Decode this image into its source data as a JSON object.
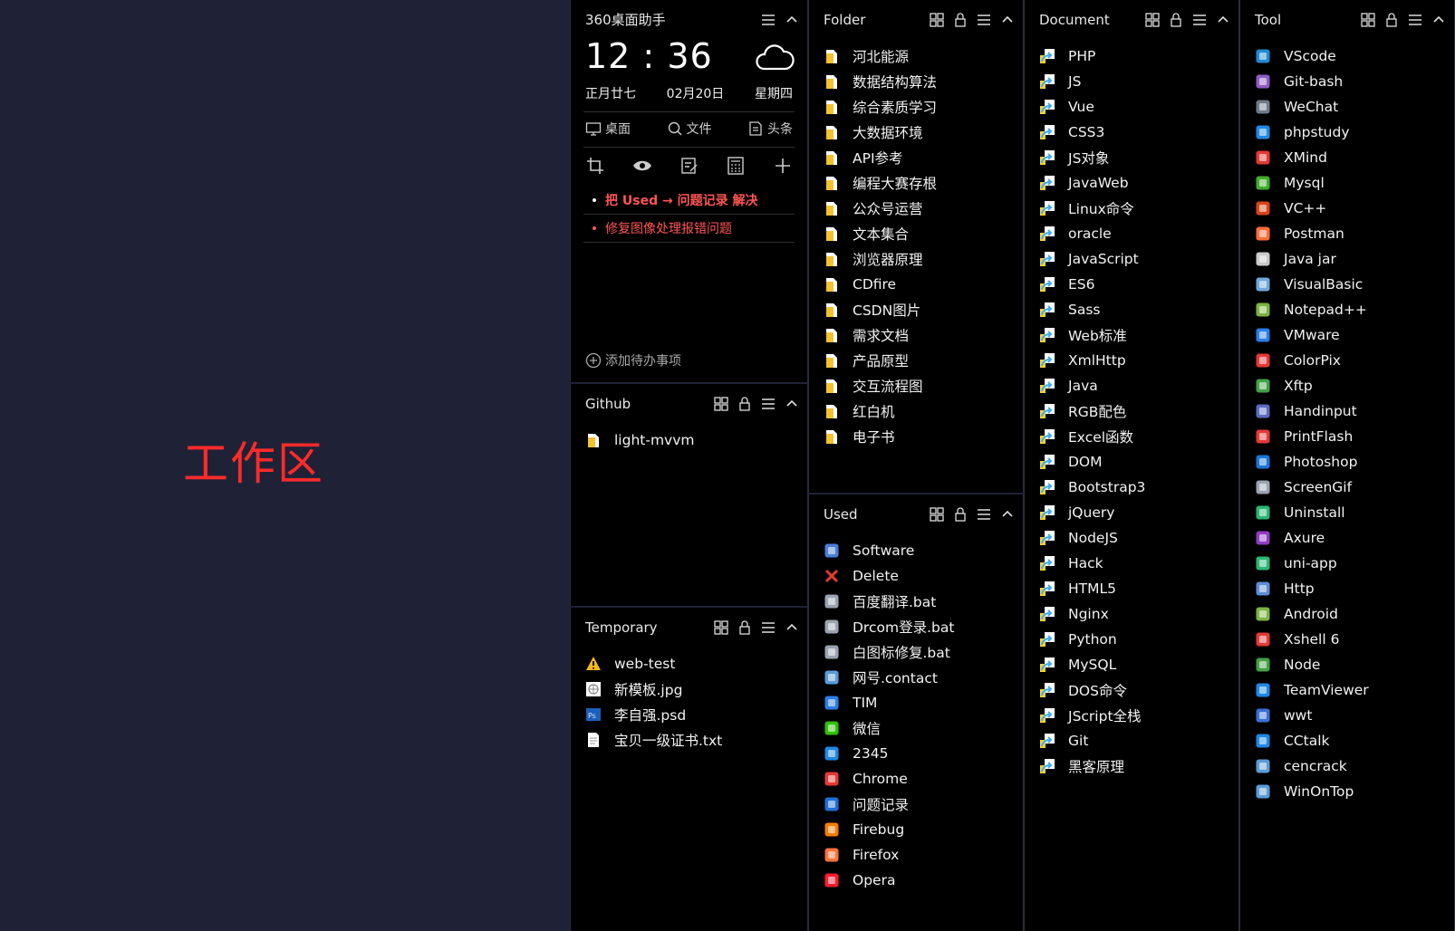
{
  "workarea": {
    "label": "工作区"
  },
  "widget": {
    "title": "360桌面助手",
    "time": "12 : 36",
    "lunar": "正月廿七",
    "date": "02月20日",
    "weekday": "星期四",
    "tabs": [
      "桌面",
      "文件",
      "头条"
    ],
    "todos": [
      {
        "text": "把 Used → 问题记录 解决",
        "bold": true
      },
      {
        "text": "修复图像处理报错问题",
        "bold": false
      }
    ],
    "add_todo": "添加待办事项",
    "todo_color": "#ff5555"
  },
  "github": {
    "title": "Github",
    "items": [
      {
        "label": "light-mvvm",
        "icon": "folder-icon"
      }
    ]
  },
  "temporary": {
    "title": "Temporary",
    "items": [
      {
        "label": "web-test",
        "icon": "warning-icon"
      },
      {
        "label": "新模板.jpg",
        "icon": "image-file-icon"
      },
      {
        "label": "李自强.psd",
        "icon": "psd-file-icon"
      },
      {
        "label": "宝贝一级证书.txt",
        "icon": "text-file-icon"
      }
    ]
  },
  "folder": {
    "title": "Folder",
    "items": [
      "河北能源",
      "数据结构算法",
      "综合素质学习",
      "大数据环境",
      "API参考",
      "编程大赛存根",
      "公众号运营",
      "文本集合",
      "浏览器原理",
      "CDfire",
      "CSDN图片",
      "需求文档",
      "产品原型",
      "交互流程图",
      "红白机",
      "电子书"
    ]
  },
  "used": {
    "title": "Used",
    "items": [
      {
        "label": "Software",
        "icon": "software-icon",
        "color": "#4a7fd6"
      },
      {
        "label": "Delete",
        "icon": "delete-icon",
        "color": "#e53935"
      },
      {
        "label": "百度翻译.bat",
        "icon": "bat-file-icon",
        "color": "#9aa4b0"
      },
      {
        "label": "Drcom登录.bat",
        "icon": "bat-file-icon",
        "color": "#9aa4b0"
      },
      {
        "label": "白图标修复.bat",
        "icon": "bat-file-icon",
        "color": "#9aa4b0"
      },
      {
        "label": "网号.contact",
        "icon": "contact-icon",
        "color": "#5b9bd5"
      },
      {
        "label": "TIM",
        "icon": "tim-icon",
        "color": "#2b7de9"
      },
      {
        "label": "微信",
        "icon": "wechat-icon",
        "color": "#2dc100"
      },
      {
        "label": "2345",
        "icon": "2345-browser-icon",
        "color": "#1e88e5"
      },
      {
        "label": "Chrome",
        "icon": "chrome-icon",
        "color": "#e53935"
      },
      {
        "label": "问题记录",
        "icon": "help-icon",
        "color": "#1e6fd9"
      },
      {
        "label": "Firebug",
        "icon": "firebug-icon",
        "color": "#f57c00"
      },
      {
        "label": "Firefox",
        "icon": "firefox-icon",
        "color": "#ff7139"
      },
      {
        "label": "Opera",
        "icon": "opera-icon",
        "color": "#ff1b2d"
      }
    ]
  },
  "document": {
    "title": "Document",
    "items": [
      "PHP",
      "JS",
      "Vue",
      "CSS3",
      "JS对象",
      "JavaWeb",
      "Linux命令",
      "oracle",
      "JavaScript",
      "ES6",
      "Sass",
      "Web标准",
      "XmlHttp",
      "Java",
      "RGB配色",
      "Excel函数",
      "DOM",
      "Bootstrap3",
      "jQuery",
      "NodeJS",
      "Hack",
      "HTML5",
      "Nginx",
      "Python",
      "MySQL",
      "DOS命令",
      "JScript全栈",
      "Git",
      "黑客原理"
    ]
  },
  "tool": {
    "title": "Tool",
    "items": [
      {
        "label": "VScode",
        "icon": "vscode-icon",
        "color": "#1f8ad2"
      },
      {
        "label": "Git-bash",
        "icon": "git-bash-icon",
        "color": "#8e5cc2"
      },
      {
        "label": "WeChat",
        "icon": "wechat-devtool-icon",
        "color": "#6e7a87"
      },
      {
        "label": "phpstudy",
        "icon": "phpstudy-icon",
        "color": "#1e88e5"
      },
      {
        "label": "XMind",
        "icon": "xmind-icon",
        "color": "#e53935"
      },
      {
        "label": "Mysql",
        "icon": "mysql-icon",
        "color": "#3fae2a"
      },
      {
        "label": "VC++",
        "icon": "vcpp-icon",
        "color": "#d84315"
      },
      {
        "label": "Postman",
        "icon": "postman-icon",
        "color": "#ff6c37"
      },
      {
        "label": "Java jar",
        "icon": "java-jar-icon",
        "color": "#c9c9c9"
      },
      {
        "label": "VisualBasic",
        "icon": "visualbasic-icon",
        "color": "#6fa8dc"
      },
      {
        "label": "Notepad++",
        "icon": "notepadpp-icon",
        "color": "#7cb342"
      },
      {
        "label": "VMware",
        "icon": "vmware-icon",
        "color": "#2b7de9"
      },
      {
        "label": "ColorPix",
        "icon": "colorpix-icon",
        "color": "#e53935"
      },
      {
        "label": "Xftp",
        "icon": "xftp-icon",
        "color": "#43a047"
      },
      {
        "label": "Handinput",
        "icon": "handinput-icon",
        "color": "#5c6bc0"
      },
      {
        "label": "PrintFlash",
        "icon": "printflash-icon",
        "color": "#e53935"
      },
      {
        "label": "Photoshop",
        "icon": "photoshop-icon",
        "color": "#1c73d6"
      },
      {
        "label": "ScreenGif",
        "icon": "screengif-icon",
        "color": "#9aa4b0"
      },
      {
        "label": "Uninstall",
        "icon": "uninstall-icon",
        "color": "#2bb673"
      },
      {
        "label": "Axure",
        "icon": "axure-icon",
        "color": "#8e3cc2"
      },
      {
        "label": "uni-app",
        "icon": "uniapp-icon",
        "color": "#2bb673"
      },
      {
        "label": "Http",
        "icon": "http-icon",
        "color": "#5c8dd6"
      },
      {
        "label": "Android",
        "icon": "android-icon",
        "color": "#7cb342"
      },
      {
        "label": "Xshell 6",
        "icon": "xshell-icon",
        "color": "#e53935"
      },
      {
        "label": "Node",
        "icon": "node-icon",
        "color": "#43a047"
      },
      {
        "label": "TeamViewer",
        "icon": "teamviewer-icon",
        "color": "#1e88e5"
      },
      {
        "label": "wwt",
        "icon": "wwt-icon",
        "color": "#3b6fd6"
      },
      {
        "label": "CCtalk",
        "icon": "cctalk-icon",
        "color": "#1e88e5"
      },
      {
        "label": "cencrack",
        "icon": "cencrack-icon",
        "color": "#5b9bd5"
      },
      {
        "label": "WinOnTop",
        "icon": "winontop-icon",
        "color": "#5b9bd5"
      }
    ]
  }
}
